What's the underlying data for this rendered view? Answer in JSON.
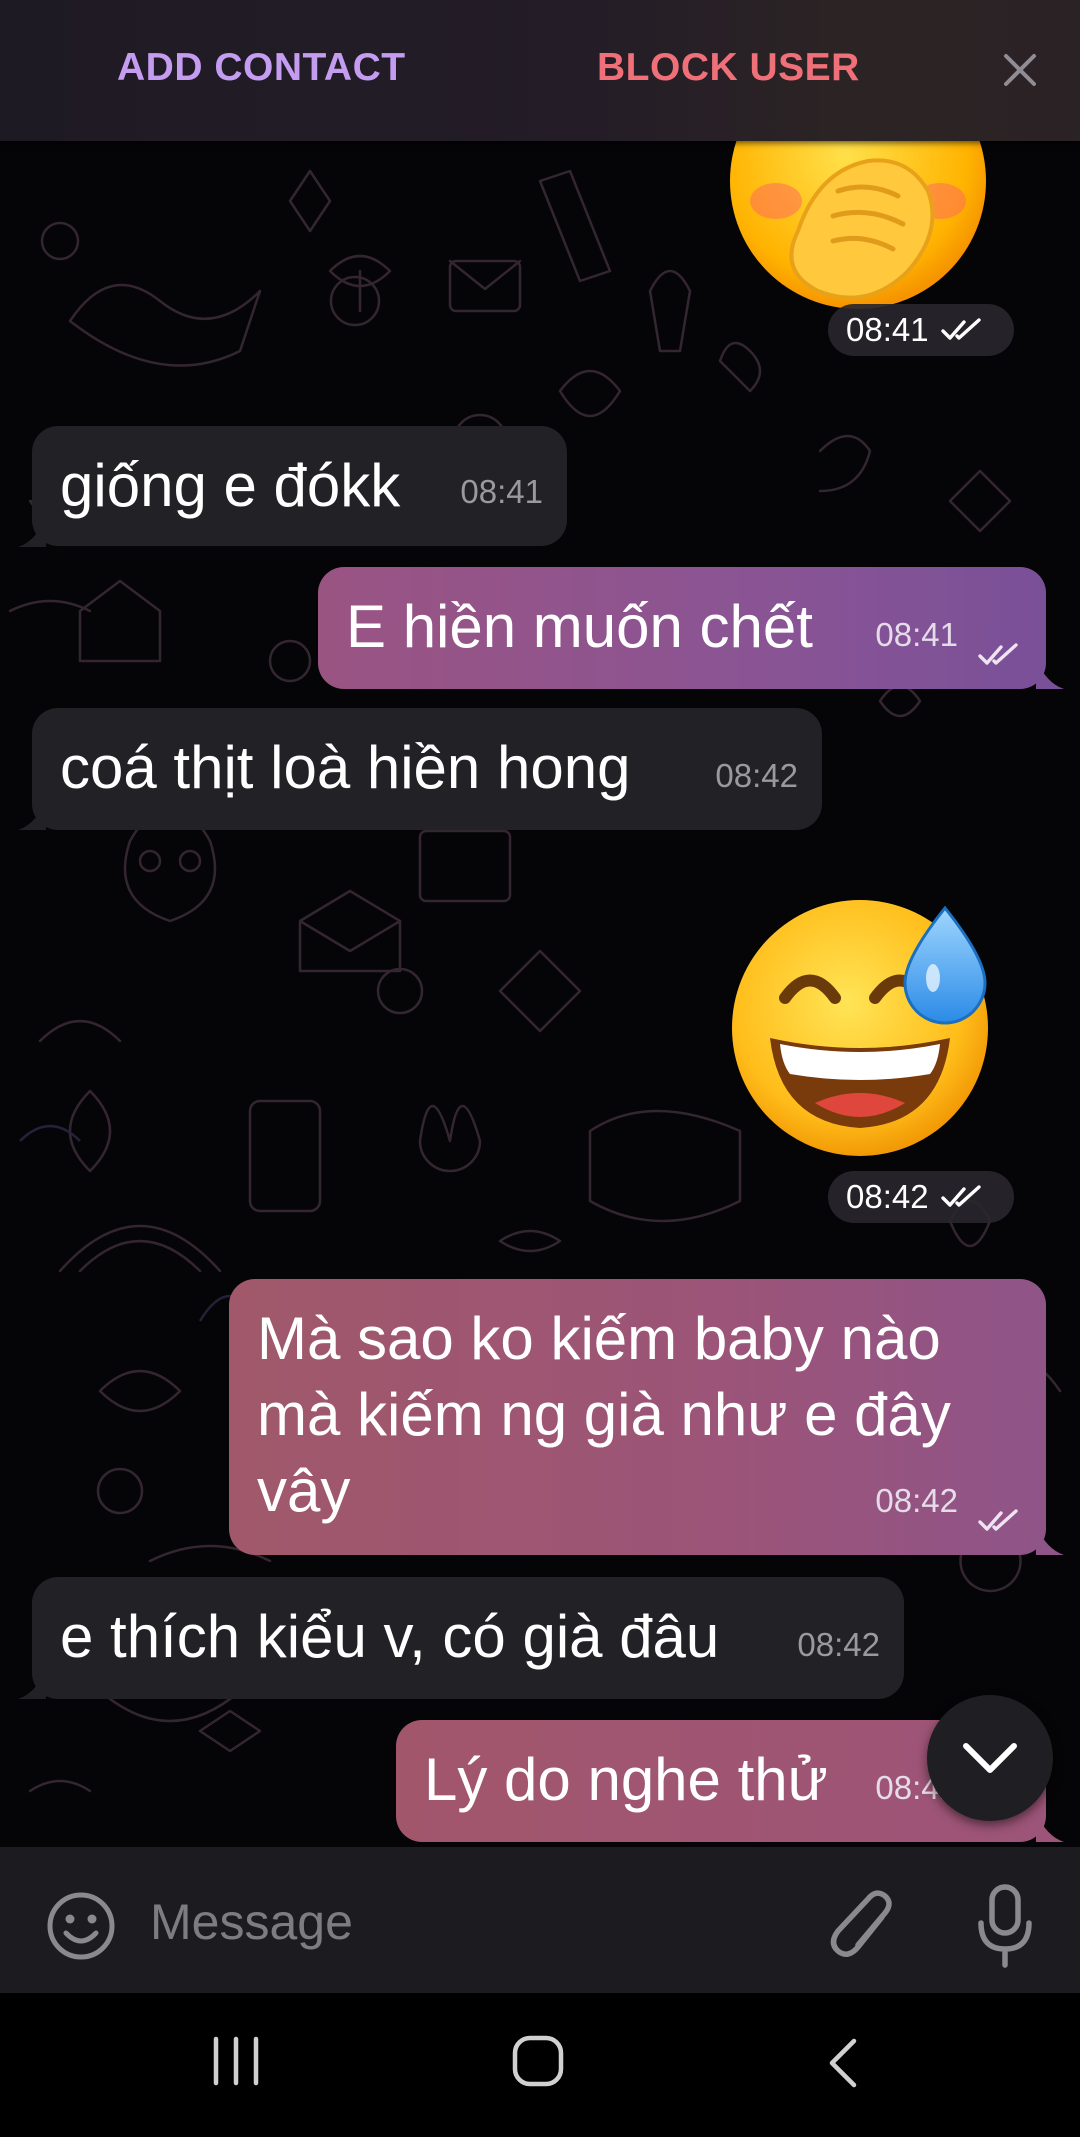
{
  "top_bar": {
    "add_contact_label": "ADD CONTACT",
    "block_user_label": "BLOCK USER",
    "close_icon": "close-icon"
  },
  "messages": [
    {
      "type": "sticker",
      "direction": "outgoing",
      "emoji": "face-with-hand-over-mouth",
      "time": "08:41",
      "status": "read"
    },
    {
      "type": "text",
      "direction": "incoming",
      "text": "giống e đókk",
      "time": "08:41"
    },
    {
      "type": "text",
      "direction": "outgoing",
      "text": "E hiền muốn chết",
      "time": "08:41",
      "status": "read"
    },
    {
      "type": "text",
      "direction": "incoming",
      "text": "coá thịt loà hiền hong",
      "time": "08:42"
    },
    {
      "type": "sticker",
      "direction": "outgoing",
      "emoji": "grinning-face-with-sweat",
      "time": "08:42",
      "status": "read"
    },
    {
      "type": "text",
      "direction": "outgoing",
      "text": "Mà sao ko kiếm baby nào\nmà kiếm ng già như e đây\nvây",
      "time": "08:42",
      "status": "read"
    },
    {
      "type": "text",
      "direction": "incoming",
      "text": "e thích kiểu v, có già đâu",
      "time": "08:42"
    },
    {
      "type": "text",
      "direction": "outgoing",
      "text": "Lý do nghe thử",
      "time": "08:42",
      "status": "read"
    }
  ],
  "input_bar": {
    "placeholder": "Message",
    "icons": [
      "smile-icon",
      "paperclip-icon",
      "microphone-icon"
    ]
  },
  "scroll_down_icon": "chevron-down-icon",
  "nav_bar": {
    "icons": [
      "recent-apps-icon",
      "home-icon",
      "back-icon"
    ]
  },
  "colors": {
    "outgoing_bubble_start": "#9a5478",
    "outgoing_bubble_end": "#7a5098",
    "incoming_bubble": "#222125",
    "add_contact": "#c49cf0",
    "block_user": "#f0707a"
  }
}
